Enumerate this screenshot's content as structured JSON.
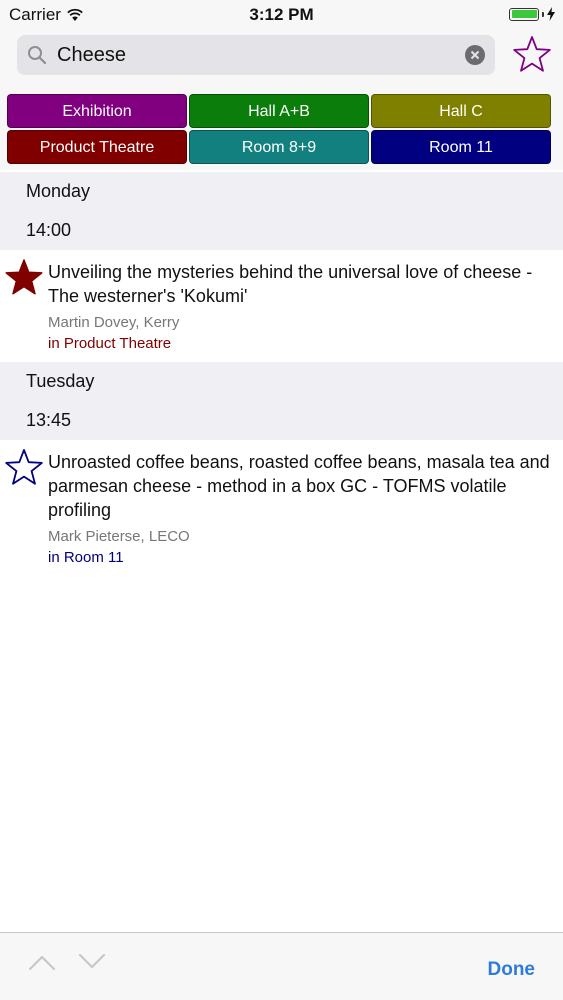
{
  "status_bar": {
    "carrier": "Carrier",
    "time": "3:12 PM"
  },
  "search": {
    "value": "Cheese",
    "placeholder": "Search"
  },
  "rooms": [
    {
      "label": "Exhibition",
      "color": "#800080"
    },
    {
      "label": "Hall A+B",
      "color": "#0a7d0a"
    },
    {
      "label": "Hall C",
      "color": "#808000"
    },
    {
      "label": "Product Theatre",
      "color": "#800000"
    },
    {
      "label": "Room 8+9",
      "color": "#138080"
    },
    {
      "label": "Room 11",
      "color": "#000080"
    }
  ],
  "results": [
    {
      "day": "Monday",
      "time": "14:00",
      "title": "Unveiling the mysteries behind the universal love of cheese - The westerner's 'Kokumi'",
      "speaker": "Martin Dovey, Kerry",
      "location": "in Product Theatre",
      "location_color": "#800000",
      "favourite": true,
      "star_color": "#800000"
    },
    {
      "day": "Tuesday",
      "time": "13:45",
      "title": "Unroasted coffee beans, roasted coffee beans, masala tea and parmesan cheese - method in a box GC - TOFMS volatile profiling",
      "speaker": "Mark Pieterse, LECO",
      "location": "in Room 11",
      "location_color": "#000080",
      "favourite": false,
      "star_color": "#000080"
    }
  ],
  "toolbar": {
    "done_label": "Done",
    "accent": "#2f7cd8"
  }
}
